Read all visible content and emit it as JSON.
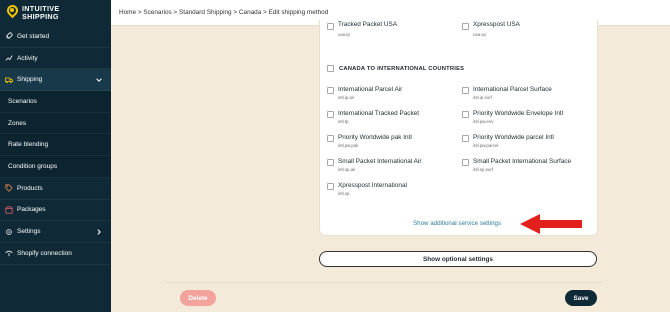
{
  "brand": {
    "line1": "INTUITIVE",
    "line2": "SHIPPING",
    "accent": "#f3c400"
  },
  "sidebar": {
    "items": [
      {
        "label": "Get started",
        "icon": "rocket-icon"
      },
      {
        "label": "Activity",
        "icon": "activity-icon"
      },
      {
        "label": "Shipping",
        "icon": "truck-icon",
        "expanded": true
      },
      {
        "label": "Scenarios"
      },
      {
        "label": "Zones"
      },
      {
        "label": "Rate blending"
      },
      {
        "label": "Condition groups"
      },
      {
        "label": "Products",
        "icon": "tag-icon"
      },
      {
        "label": "Packages",
        "icon": "package-icon"
      },
      {
        "label": "Settings",
        "icon": "gear-icon"
      },
      {
        "label": "Shopify connection",
        "icon": "plug-icon"
      }
    ]
  },
  "breadcrumb": "Home > Scenarios > Standard Shipping > Canada > Edit shipping method",
  "top_options": [
    {
      "label": "Tracked Packet USA",
      "code": "usa.tp"
    },
    {
      "label": "Xpresspost USA",
      "code": "usa.xp"
    }
  ],
  "section": {
    "title": "CANADA TO INTERNATIONAL COUNTRIES"
  },
  "options": [
    {
      "label": "International Parcel Air",
      "code": "intl.ip.air"
    },
    {
      "label": "International Parcel Surface",
      "code": "intl.ip.surf"
    },
    {
      "label": "International Tracked Packet",
      "code": "intl.tp"
    },
    {
      "label": "Priority Worldwide Envelope Intl",
      "code": "intl.pw.env"
    },
    {
      "label": "Priority Worldwide pak Intl",
      "code": "intl.pw.pak"
    },
    {
      "label": "Priority Worldwide parcel Intl",
      "code": "intl.pw.parcel"
    },
    {
      "label": "Small Packet International Air",
      "code": "intl.sp.air"
    },
    {
      "label": "Small Packet International Surface",
      "code": "intl.sp.surf"
    },
    {
      "label": "Xpresspost International",
      "code": "intl.xp"
    }
  ],
  "show_additional": "Show additional service settings",
  "show_optional": "Show optional settings",
  "buttons": {
    "delete": "Delete",
    "save": "Save"
  },
  "colors": {
    "sidebar": "#0f2a36",
    "link": "#2f7d9b",
    "arrow": "#e3201b",
    "delete": "#f2a39b"
  }
}
